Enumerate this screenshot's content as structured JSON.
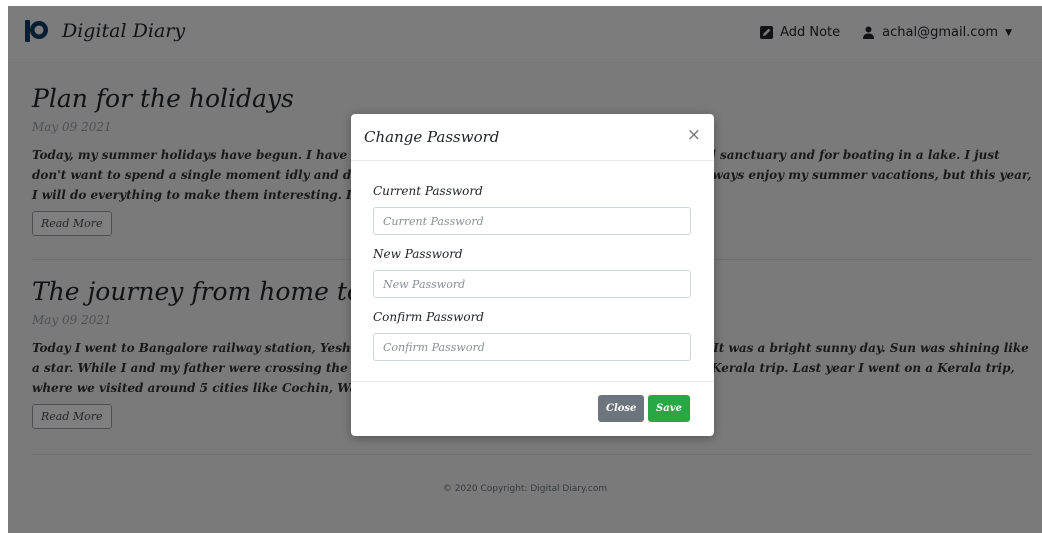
{
  "navbar": {
    "brand": "Digital Diary",
    "add_note": "Add Note",
    "user_email": "achal@gmail.com"
  },
  "posts": [
    {
      "title": "Plan for the holidays",
      "date": "May 09 2021",
      "excerpt": "Today, my summer holidays have begun. I have some plans like visiting my hometown, going to a bird sanctuary and for boating in a lake. I just don't want to spend a single moment idly and definitely want to enjoy my summer vacation. I don't always enjoy my summer vacations, but this year, I will do everything to make them interesting. I now need to go. I'm excited and eagerly ...",
      "read_more": "Read More"
    },
    {
      "title": "The journey from home to the railway station",
      "date": "May 09 2021",
      "excerpt": "Today I went to Bangalore railway station, Yeshwantpur to catch the Kurla Express to go to Mumbai. It was a bright sunny day. Sun was shining like a star. While I and my father were crossing the Orion mall, my father reminded me of our last year's Kerala trip. Last year I went on a Kerala trip, where we visited around 5 cities like Cochin, Wayanad, Munnar, ...",
      "read_more": "Read More"
    }
  ],
  "footer": {
    "copyright": "© 2020 Copyright: Digital Diary.com"
  },
  "modal": {
    "title": "Change Password",
    "close_icon": "×",
    "fields": [
      {
        "label": "Current Password",
        "placeholder": "Current Password",
        "value": ""
      },
      {
        "label": "New Password",
        "placeholder": "New Password",
        "value": ""
      },
      {
        "label": "Confirm Password",
        "placeholder": "Confirm Password",
        "value": ""
      }
    ],
    "close_label": "Close",
    "save_label": "Save"
  },
  "icons": {
    "brand": "brand-logo-icon",
    "add_note": "edit-note-icon",
    "user": "user-icon",
    "dropdown": "caret-down-icon"
  },
  "colors": {
    "brand_blue": "#0d3b66",
    "save_green": "#28a745",
    "close_gray": "#6c757d",
    "backdrop": "rgba(0,0,0,0.5)"
  }
}
